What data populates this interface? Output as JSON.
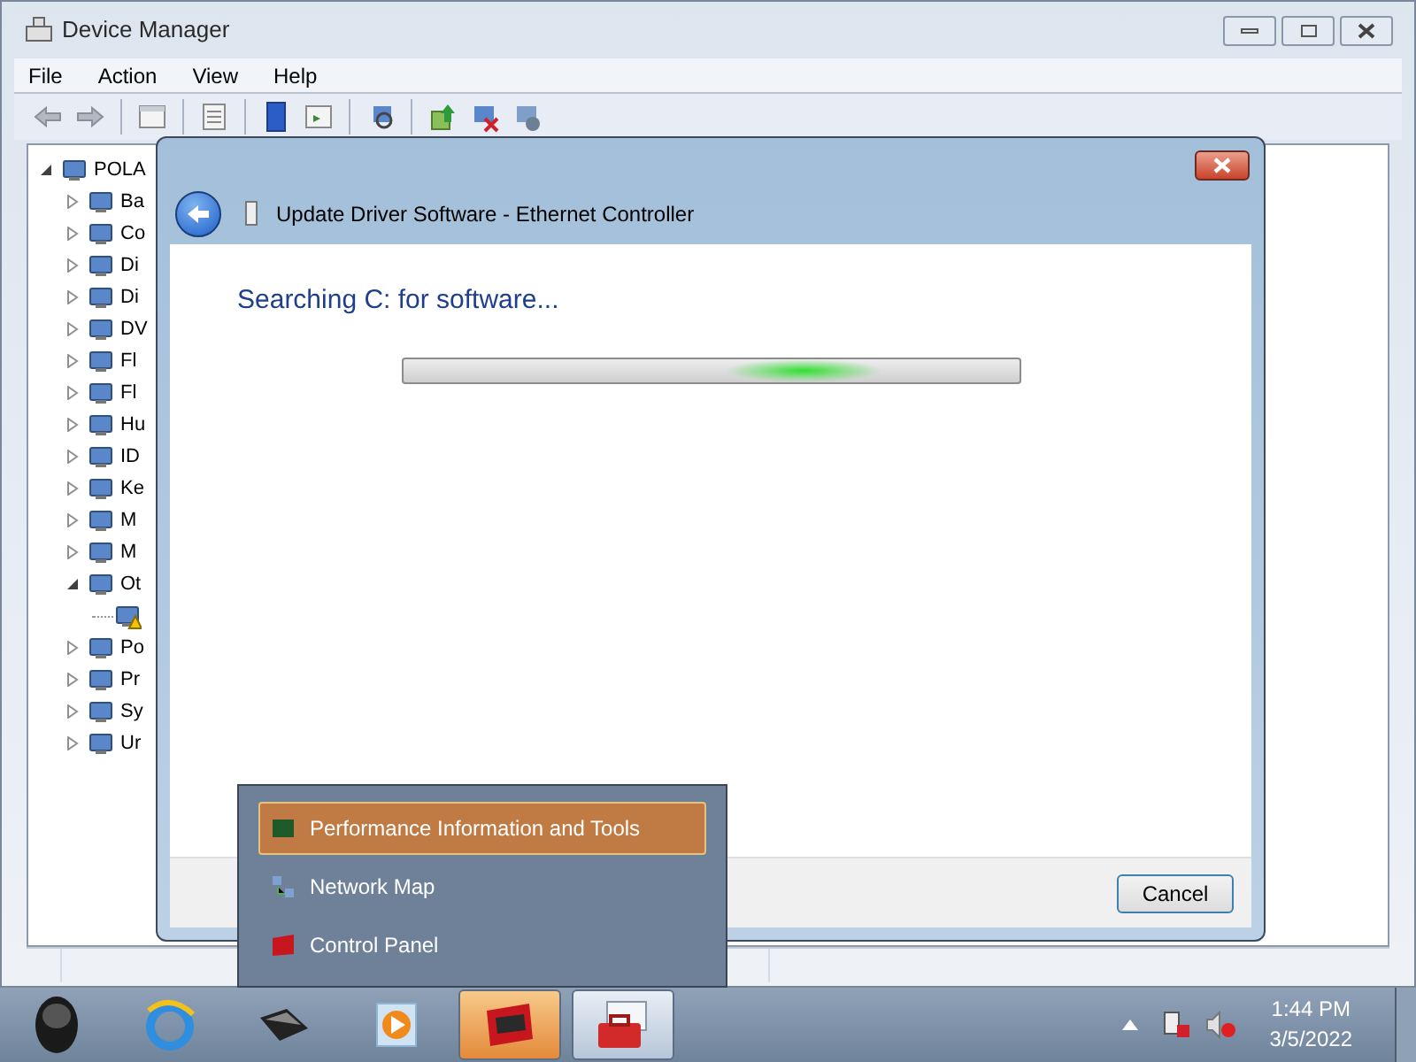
{
  "window": {
    "title": "Device Manager"
  },
  "menu": [
    "File",
    "Action",
    "View",
    "Help"
  ],
  "tree": {
    "label": "POLA",
    "expanded": true,
    "children": [
      {
        "label": "Ba",
        "expanded": false
      },
      {
        "label": "Co",
        "expanded": false
      },
      {
        "label": "Di",
        "expanded": false
      },
      {
        "label": "Di",
        "expanded": false
      },
      {
        "label": "DV",
        "expanded": false
      },
      {
        "label": "Fl",
        "expanded": false
      },
      {
        "label": "Fl",
        "expanded": false
      },
      {
        "label": "Hu",
        "expanded": false
      },
      {
        "label": "ID",
        "expanded": false
      },
      {
        "label": "Ke",
        "expanded": false
      },
      {
        "label": "M",
        "expanded": false
      },
      {
        "label": "M",
        "expanded": false
      },
      {
        "label": "Ot",
        "expanded": true,
        "children": [
          {
            "warning": true
          }
        ]
      },
      {
        "label": "Po",
        "expanded": false
      },
      {
        "label": "Pr",
        "expanded": false
      },
      {
        "label": "Sy",
        "expanded": false
      },
      {
        "label": "Ur",
        "expanded": false
      }
    ]
  },
  "dialog": {
    "title": "Update Driver Software - Ethernet Controller",
    "heading": "Searching C: for software...",
    "progress": {
      "kind": "marquee",
      "level": 0.65
    },
    "buttons": [
      "Cancel"
    ]
  },
  "jump_list": {
    "items": [
      {
        "label": "Performance Information and Tools",
        "selected": true
      },
      {
        "label": "Network Map",
        "selected": false
      },
      {
        "label": "Control Panel",
        "selected": false
      }
    ]
  },
  "taskbar": {
    "buttons": [
      {
        "kind": "orb",
        "open": false,
        "active": false
      },
      {
        "kind": "browser",
        "open": false,
        "active": false
      },
      {
        "kind": "drive",
        "open": false,
        "active": false
      },
      {
        "kind": "player",
        "open": false,
        "active": false
      },
      {
        "kind": "panel",
        "open": true,
        "active": true
      },
      {
        "kind": "toolbox",
        "open": true,
        "active": false
      }
    ]
  },
  "clock": {
    "time": "1:44 PM",
    "date": "3/5/2022"
  }
}
